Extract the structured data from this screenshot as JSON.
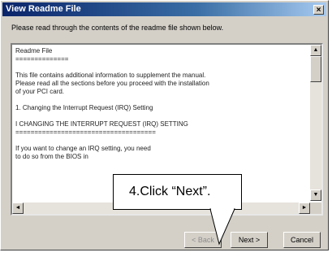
{
  "window": {
    "title": "View Readme File",
    "close_glyph": "×"
  },
  "instruction": "Please read through the contents of the readme file shown below.",
  "readme_lines": [
    "Readme File",
    "==============",
    "",
    "This file contains additional information to supplement the manual.",
    "Please read all the sections before you proceed with the installation",
    "of your PCI card.",
    "",
    "  1.   Changing the Interrupt Request (IRQ) Setting",
    "",
    "I   CHANGING THE INTERRUPT REQUEST (IRQ) SETTING",
    "=====================================",
    "",
    "If you want to change an IRQ setting, you need",
    "to do so from the BIOS in"
  ],
  "scroll": {
    "up_glyph": "▲",
    "down_glyph": "▼",
    "left_glyph": "◄",
    "right_glyph": "►"
  },
  "buttons": {
    "back": "< Back",
    "next": "Next >",
    "cancel": "Cancel"
  },
  "callout": {
    "text": "4.Click “Next”."
  }
}
